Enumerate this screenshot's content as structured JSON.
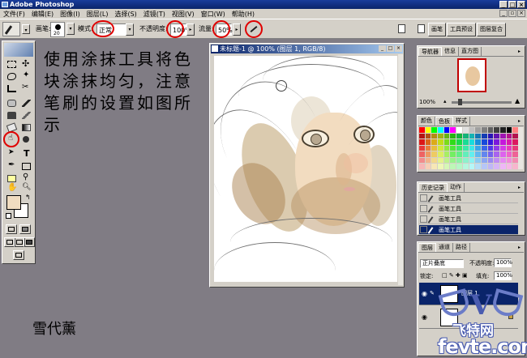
{
  "app": {
    "title": "Adobe Photoshop"
  },
  "menu": [
    "文件(F)",
    "编辑(E)",
    "图像(I)",
    "图层(L)",
    "选择(S)",
    "滤镜(T)",
    "视图(V)",
    "窗口(W)",
    "帮助(H)"
  ],
  "options": {
    "brush_label": "画笔:",
    "brush_size": "20",
    "mode_label": "模式:",
    "mode_value": "正常",
    "opacity_label": "不透明度:",
    "opacity_value": "100%",
    "flow_label": "流量:",
    "flow_value": "50%"
  },
  "palette_well": [
    "画笔",
    "工具预设",
    "图层复合"
  ],
  "instruction": "使用涂抹工具将色块涂抹均匀，注意笔刷的设置如图所示",
  "signature": "雪代薰",
  "document": {
    "title": "未标题-1 @ 100% (图层 1, RGB/8)"
  },
  "navigator": {
    "tabs": [
      "导航器",
      "信息",
      "直方图"
    ],
    "zoom": "100%"
  },
  "swatches": {
    "tabs": [
      "颜色",
      "色板",
      "样式"
    ],
    "colors": [
      "#ff0000",
      "#ffff00",
      "#00ff00",
      "#00ffff",
      "#0000ff",
      "#ff00ff",
      "#ffffff",
      "#e0e0e0",
      "#c0c0c0",
      "#a0a0a0",
      "#808080",
      "#606060",
      "#404040",
      "#202020",
      "#000000",
      "#ff8080"
    ]
  },
  "history": {
    "tabs": [
      "历史记录",
      "动作"
    ],
    "items": [
      "画笔工具",
      "画笔工具",
      "画笔工具",
      "画笔工具"
    ]
  },
  "layers": {
    "tabs": [
      "图层",
      "通道",
      "路径"
    ],
    "blend_mode": "正片叠底",
    "opacity_label": "不透明度:",
    "opacity_value": "100%",
    "lock_label": "锁定:",
    "fill_label": "填充:",
    "fill_value": "100%",
    "items": [
      "图层 1",
      ""
    ]
  },
  "logo": {
    "line1": "飞特网",
    "line2": "fevte.com"
  }
}
